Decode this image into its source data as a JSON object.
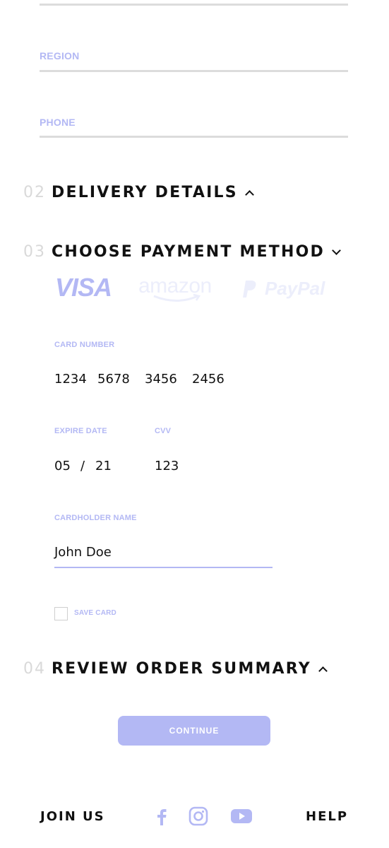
{
  "form": {
    "region_label": "REGION",
    "phone_label": "PHONE"
  },
  "sections": {
    "delivery": {
      "number": "02",
      "title": "DELIVERY DETAILS",
      "state": "collapsed"
    },
    "payment": {
      "number": "03",
      "title": "CHOOSE PAYMENT METHOD",
      "state": "expanded"
    },
    "review": {
      "number": "04",
      "title": "REVIEW ORDER SUMMARY",
      "state": "collapsed"
    }
  },
  "payment_methods": {
    "visa": "VISA",
    "amazon": "amazon",
    "paypal": "PayPal",
    "selected": "VISA"
  },
  "card": {
    "number_label": "CARD NUMBER",
    "number_groups": [
      "1234",
      "5678",
      "3456",
      "2456"
    ],
    "expire_label": "EXPIRE DATE",
    "expire_month": "05",
    "expire_sep": "/",
    "expire_year": "21",
    "cvv_label": "CVV",
    "cvv_value": "123",
    "holder_label": "CARDHOLDER NAME",
    "holder_value": "John Doe",
    "save_label": "SAVE CARD",
    "save_checked": false
  },
  "actions": {
    "continue_label": "CONTINUE"
  },
  "footer": {
    "join_label": "JOIN US",
    "help_label": "HELP",
    "social_icons": [
      "facebook-icon",
      "instagram-icon",
      "youtube-icon"
    ]
  },
  "colors": {
    "accent": "#b3b8f4",
    "divider": "#dcdcdc",
    "text": "#111111",
    "muted_number": "#d9d9d9"
  }
}
